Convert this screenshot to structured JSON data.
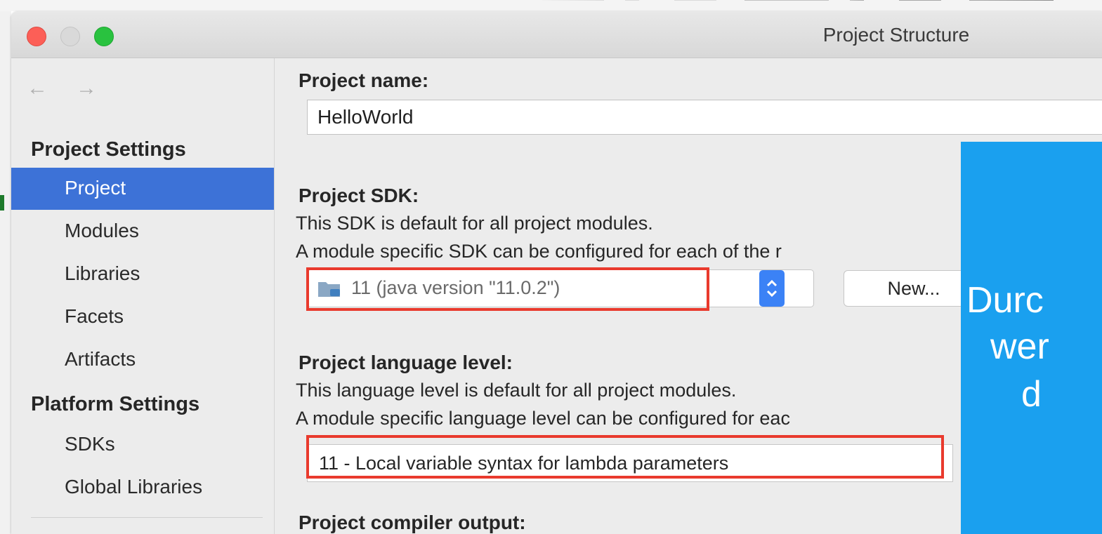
{
  "window": {
    "title": "Project Structure"
  },
  "sidebar": {
    "back_arrow": "←",
    "forward_arrow": "→",
    "project_settings_title": "Project Settings",
    "project_items": [
      {
        "label": "Project",
        "selected": true
      },
      {
        "label": "Modules",
        "selected": false
      },
      {
        "label": "Libraries",
        "selected": false
      },
      {
        "label": "Facets",
        "selected": false
      },
      {
        "label": "Artifacts",
        "selected": false
      }
    ],
    "platform_settings_title": "Platform Settings",
    "platform_items": [
      {
        "label": "SDKs",
        "selected": false
      },
      {
        "label": "Global Libraries",
        "selected": false
      }
    ]
  },
  "content": {
    "project_name_label": "Project name:",
    "project_name_value": "HelloWorld",
    "sdk_label": "Project SDK:",
    "sdk_desc1": "This SDK is default for all project modules.",
    "sdk_desc2": "A module specific SDK can be configured for each of the r",
    "sdk_value": "11 (java version \"11.0.2\")",
    "new_button": "New...",
    "lang_label": "Project language level:",
    "lang_desc1": "This language level is default for all project modules.",
    "lang_desc2": "A module specific language level can be configured for eac",
    "lang_value": "11 - Local variable syntax for lambda parameters",
    "compiler_label": "Project compiler output:"
  },
  "overlay": {
    "line1": "Durc",
    "line2": "wer",
    "line3": "d"
  },
  "colors": {
    "selection": "#3d72d7",
    "highlight": "#e93a2d",
    "overlay": "#1aa0ef"
  }
}
